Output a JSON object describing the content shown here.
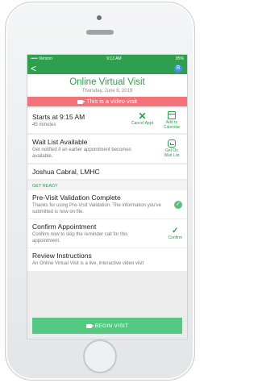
{
  "status_bar": {
    "carrier": "••••• Verizon",
    "time": "9:13 AM",
    "battery": "85%"
  },
  "nav": {
    "back": "<",
    "avatar_letter": "B"
  },
  "header": {
    "title": "Online Virtual Visit",
    "date": "Thursday, June 6, 2019"
  },
  "banner": {
    "text": "This is a video visit"
  },
  "appointment": {
    "start": "Starts at 9:15 AM",
    "duration": "45 minutes",
    "cancel_label": "Cancel Appt",
    "calendar_label": "Add to Calendar"
  },
  "waitlist": {
    "title": "Wait List Available",
    "desc": "Get notified if an earlier appointment becomes available.",
    "action_label": "Get On Wait List"
  },
  "provider": {
    "name": "Joshua Cabral, LMHC"
  },
  "get_ready": {
    "section_label": "GET READY",
    "validation_title": "Pre-Visit Validation Complete",
    "validation_desc": "Thanks for using Pre-Visit Validation. The information you've submitted is now on file.",
    "confirm_title": "Confirm Appointment",
    "confirm_desc": "Confirm now to skip the reminder call for this appointment.",
    "confirm_label": "Confirm",
    "review_title": "Review Instructions",
    "review_desc": "An Online Virtual Visit is a live, interactive video visit"
  },
  "begin_button": {
    "label": "BEGIN VISIT"
  },
  "colors": {
    "accent": "#2e9e4f",
    "banner": "#f2737a",
    "button": "#55c982"
  }
}
